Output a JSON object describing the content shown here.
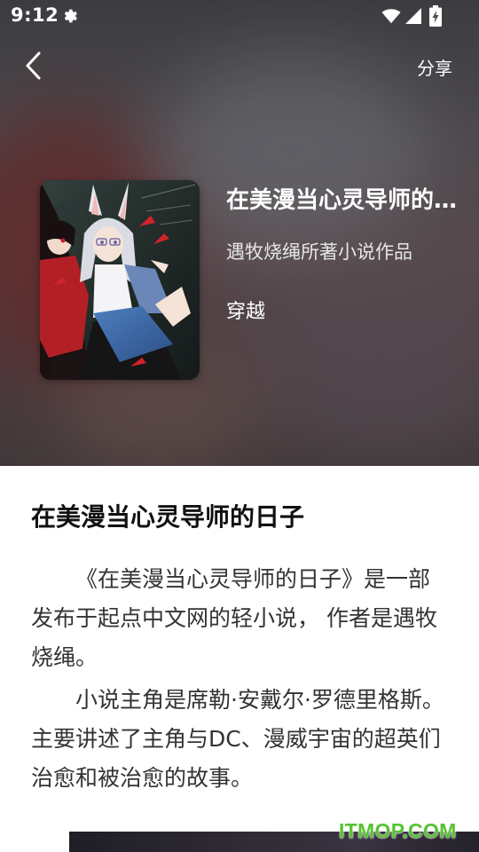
{
  "status_bar": {
    "time": "9:12",
    "icons": [
      "settings-icon",
      "wifi-icon",
      "signal-icon",
      "battery-charging-icon"
    ]
  },
  "header": {
    "back_icon": "chevron-left-icon",
    "share_label": "分享"
  },
  "book": {
    "title": "在美漫当心灵导师的…",
    "author_line": "遇牧烧绳所著小说作品",
    "genre": "穿越"
  },
  "content": {
    "title": "在美漫当心灵导师的日子",
    "paragraphs": [
      "《在美漫当心灵导师的日子》是一部发布于起点中文网的轻小说， 作者是遇牧烧绳。",
      "小说主角是席勒·安戴尔·罗德里格斯。 主要讲述了主角与DC、漫威宇宙的超英们治愈和被治愈的故事。"
    ]
  },
  "watermark": "ITMOP.COM",
  "colors": {
    "watermark": "#58c234",
    "hero_overlay": "#5a4f54"
  }
}
